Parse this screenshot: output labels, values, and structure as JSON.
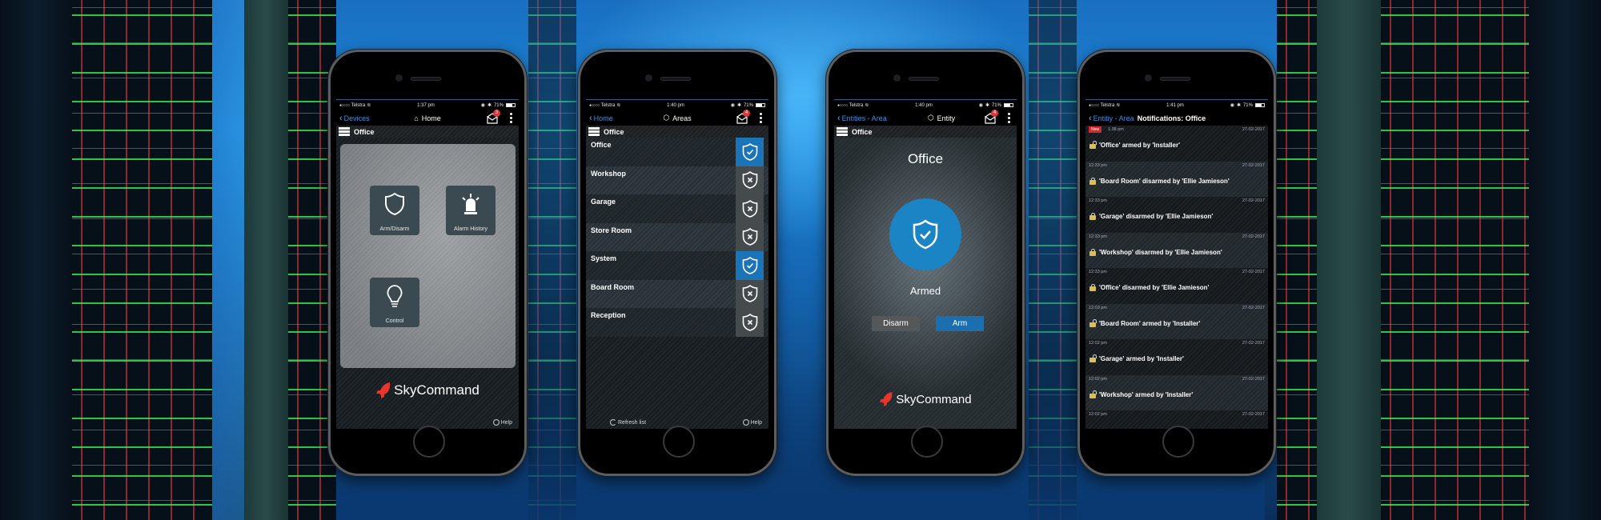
{
  "colors": {
    "accent_blue": "#1b74b8",
    "link_blue": "#3b8ed8",
    "badge_red": "#d9363e",
    "new_red": "#d6282c",
    "disarmed_gray": "#454a4d",
    "logo_red": "#e8362b"
  },
  "status_bar": {
    "carrier": "Telstra",
    "battery": "71%",
    "battery_level": 0.71
  },
  "phones": [
    {
      "status_time": "1:37 pm",
      "nav": {
        "back_label": "Devices",
        "title": "Home",
        "title_icon": "home-icon",
        "mail_badge": "3",
        "menu_icon": "kebab-menu-icon"
      },
      "subbar_title": "Office",
      "tiles": [
        {
          "label": "Arm/Disarm",
          "icon": "shield-icon"
        },
        {
          "label": "Alarm History",
          "icon": "siren-icon"
        },
        {
          "label": "Control",
          "icon": "lightbulb-icon"
        }
      ],
      "brand": "SkyCommand",
      "help_label": "Help"
    },
    {
      "status_time": "1:40 pm",
      "nav": {
        "back_label": "Home",
        "title": "Areas",
        "title_icon": "shield-outline-icon",
        "mail_badge": "4",
        "menu_icon": "kebab-menu-icon"
      },
      "subbar_title": "Office",
      "areas": [
        {
          "name": "Office",
          "state": "armed"
        },
        {
          "name": "Workshop",
          "state": "disarmed"
        },
        {
          "name": "Garage",
          "state": "disarmed"
        },
        {
          "name": "Store Room",
          "state": "disarmed"
        },
        {
          "name": "System",
          "state": "armed"
        },
        {
          "name": "Board Room",
          "state": "disarmed"
        },
        {
          "name": "Reception",
          "state": "disarmed"
        }
      ],
      "refresh_label": "Refresh list",
      "help_label": "Help"
    },
    {
      "status_time": "1:40 pm",
      "nav": {
        "back_label": "Entities - Area",
        "title": "Entity",
        "title_icon": "shield-outline-icon",
        "mail_badge": "4",
        "menu_icon": "kebab-menu-icon"
      },
      "subbar_title": "Office",
      "entity_name": "Office",
      "entity_state": "Armed",
      "disarm_label": "Disarm",
      "arm_label": "Arm",
      "brand": "SkyCommand"
    },
    {
      "status_time": "1:41 pm",
      "nav": {
        "back_label": "Entitiy - Area",
        "title": "Notifications: Office"
      },
      "notifications": [
        {
          "is_new": true,
          "new_label": "New",
          "time": "1:38 pm",
          "date": "27-02-2017",
          "message": "'Office' armed by 'Installer'",
          "lock": "armed"
        },
        {
          "is_new": false,
          "time": "12:33 pm",
          "date": "27-02-2017",
          "message": "'Board Room' disarmed by 'Ellie Jamieson'",
          "lock": "disarmed"
        },
        {
          "is_new": false,
          "time": "12:33 pm",
          "date": "27-02-2017",
          "message": "'Garage' disarmed by 'Ellie Jamieson'",
          "lock": "disarmed"
        },
        {
          "is_new": false,
          "time": "12:33 pm",
          "date": "27-02-2017",
          "message": "'Workshop' disarmed by 'Ellie Jamieson'",
          "lock": "disarmed"
        },
        {
          "is_new": false,
          "time": "12:33 pm",
          "date": "27-02-2017",
          "message": "'Office' disarmed by 'Ellie Jamieson'",
          "lock": "disarmed"
        },
        {
          "is_new": false,
          "time": "12:03 pm",
          "date": "27-02-2017",
          "message": "'Board Room' armed by 'Installer'",
          "lock": "armed"
        },
        {
          "is_new": false,
          "time": "12:02 pm",
          "date": "27-02-2017",
          "message": "'Garage' armed by 'Installer'",
          "lock": "armed"
        },
        {
          "is_new": false,
          "time": "12:02 pm",
          "date": "27-02-2017",
          "message": "'Workshop' armed by 'Installer'",
          "lock": "armed"
        },
        {
          "is_new": false,
          "time": "12:02 pm",
          "date": "27-02-2017",
          "message": "",
          "lock": ""
        }
      ]
    }
  ]
}
